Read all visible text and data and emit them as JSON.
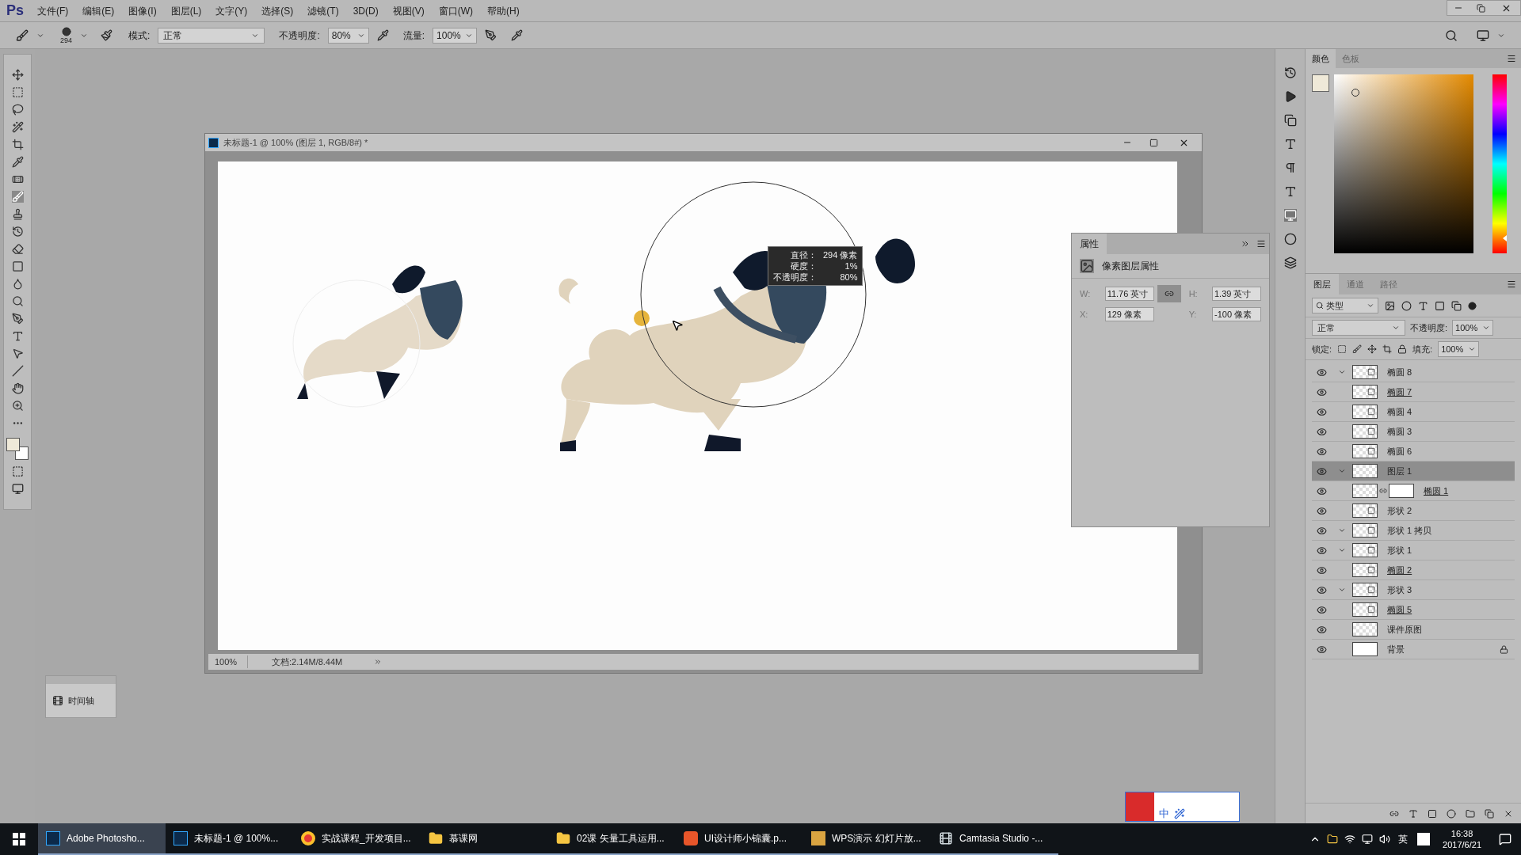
{
  "app": {
    "logo": "Ps"
  },
  "menu": [
    "文件(F)",
    "编辑(E)",
    "图像(I)",
    "图层(L)",
    "文字(Y)",
    "选择(S)",
    "滤镜(T)",
    "3D(D)",
    "视图(V)",
    "窗口(W)",
    "帮助(H)"
  ],
  "options_bar": {
    "brush_size": "294",
    "mode_label": "模式:",
    "mode_value": "正常",
    "opacity_label": "不透明度:",
    "opacity_value": "80%",
    "flow_label": "流量:",
    "flow_value": "100%"
  },
  "document": {
    "title": "未标题-1 @ 100% (图层 1, RGB/8#) *",
    "zoom": "100%",
    "doc_info": "文档:2.14M/8.44M"
  },
  "brush_tooltip": [
    {
      "label": "直径：",
      "value": "294 像素"
    },
    {
      "label": "硬度：",
      "value": "1%"
    },
    {
      "label": "不透明度：",
      "value": "80%"
    }
  ],
  "properties": {
    "tab": "属性",
    "header": "像素图层属性",
    "fields": [
      {
        "label": "W:",
        "value": "11.76 英寸"
      },
      {
        "label": "H:",
        "value": "1.39 英寸"
      },
      {
        "label": "X:",
        "value": "129 像素"
      },
      {
        "label": "Y:",
        "value": "-100 像素"
      }
    ]
  },
  "timeline_panel": {
    "label": "时间轴"
  },
  "color_panel": {
    "hue_slider": {
      "level": 0.07
    },
    "tabs": [
      {
        "label": "颜色",
        "selected": true
      },
      {
        "label": "色板",
        "selected": false
      }
    ]
  },
  "layers_panel": {
    "tabs": [
      {
        "label": "图层",
        "selected": true
      },
      {
        "label": "通道",
        "selected": false
      },
      {
        "label": "路径",
        "selected": false
      }
    ],
    "filter": "类型",
    "blend_mode": "正常",
    "opacity_label": "不透明度:",
    "opacity_value": "100%",
    "lock_label": "锁定:",
    "fill_label": "填充:",
    "fill_value": "100%",
    "layers": [
      {
        "name": "椭圆 8",
        "kind": "shape",
        "clipped": true,
        "underlined": false,
        "selected": false
      },
      {
        "name": "椭圆 7",
        "kind": "shape",
        "clipped": false,
        "underlined": true,
        "selected": false
      },
      {
        "name": "椭圆 4",
        "kind": "shape",
        "clipped": false,
        "underlined": false,
        "selected": false
      },
      {
        "name": "椭圆 3",
        "kind": "shape",
        "clipped": false,
        "underlined": false,
        "selected": false
      },
      {
        "name": "椭圆 6",
        "kind": "shape",
        "clipped": false,
        "underlined": false,
        "selected": false
      },
      {
        "name": "图层 1",
        "kind": "pixel",
        "clipped": true,
        "underlined": false,
        "selected": true
      },
      {
        "name": "椭圆 1",
        "kind": "masked",
        "clipped": false,
        "underlined": true,
        "selected": false
      },
      {
        "name": "形状 2",
        "kind": "shape",
        "clipped": false,
        "underlined": false,
        "selected": false
      },
      {
        "name": "形状 1 拷贝",
        "kind": "shape",
        "clipped": true,
        "underlined": false,
        "selected": false
      },
      {
        "name": "形状 1",
        "kind": "shape",
        "clipped": true,
        "underlined": false,
        "selected": false
      },
      {
        "name": "椭圆 2",
        "kind": "shape",
        "clipped": false,
        "underlined": true,
        "selected": false
      },
      {
        "name": "形状 3",
        "kind": "shape",
        "clipped": true,
        "underlined": false,
        "selected": false
      },
      {
        "name": "椭圆 5",
        "kind": "shape",
        "clipped": false,
        "underlined": true,
        "selected": false
      },
      {
        "name": "课件原图",
        "kind": "pixel",
        "clipped": false,
        "underlined": false,
        "selected": false
      },
      {
        "name": "背景",
        "kind": "background",
        "clipped": false,
        "underlined": false,
        "selected": false
      }
    ]
  },
  "ime_toolbar": {
    "mode": "中"
  },
  "taskbar": {
    "items": [
      {
        "label": "Adobe Photosho...",
        "kind": "ps",
        "selected": true
      },
      {
        "label": "未标题-1 @ 100%...",
        "kind": "ps",
        "selected": false
      },
      {
        "label": "实战课程_开发项目...",
        "kind": "chrome",
        "selected": false
      },
      {
        "label": "慕课网",
        "kind": "folder",
        "selected": false
      },
      {
        "label": "02课 矢量工具运用...",
        "kind": "folder",
        "selected": false
      },
      {
        "label": "UI设计师小锦囊.p...",
        "kind": "wps",
        "selected": false
      },
      {
        "label": "WPS演示 幻灯片放...",
        "kind": "slides",
        "selected": false
      },
      {
        "label": "Camtasia Studio -...",
        "kind": "camtasia",
        "selected": false
      }
    ],
    "language": "英",
    "time": "16:38",
    "date": "2017/6/21"
  }
}
